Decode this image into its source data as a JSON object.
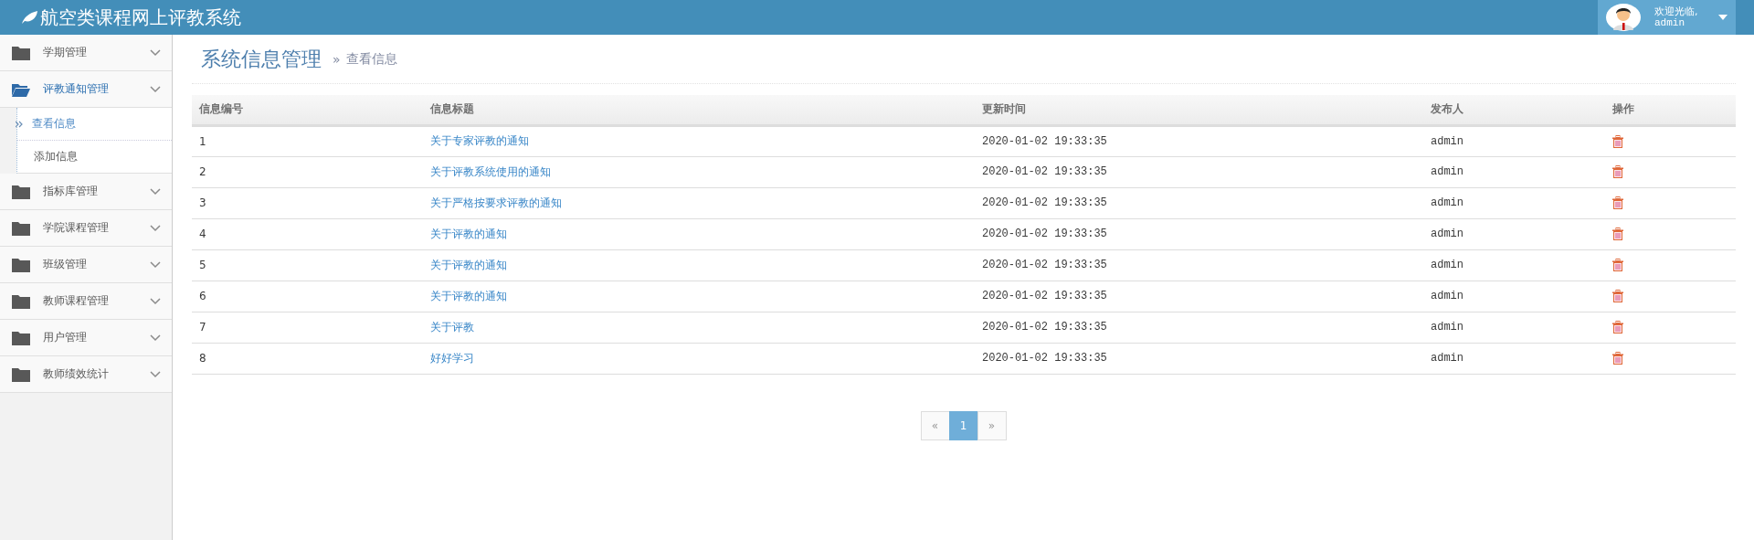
{
  "header": {
    "title": "航空类课程网上评教系统",
    "user": {
      "greeting": "欢迎光临,",
      "name": "admin"
    }
  },
  "sidebar": {
    "items": [
      {
        "label": "学期管理",
        "expanded": false
      },
      {
        "label": "评教通知管理",
        "expanded": true,
        "children": [
          {
            "label": "查看信息",
            "selected": true
          },
          {
            "label": "添加信息",
            "selected": false
          }
        ]
      },
      {
        "label": "指标库管理",
        "expanded": false
      },
      {
        "label": "学院课程管理",
        "expanded": false
      },
      {
        "label": "班级管理",
        "expanded": false
      },
      {
        "label": "教师课程管理",
        "expanded": false
      },
      {
        "label": "用户管理",
        "expanded": false
      },
      {
        "label": "教师绩效统计",
        "expanded": false
      }
    ]
  },
  "page": {
    "title": "系统信息管理",
    "breadcrumb_mark": "»",
    "subtitle": "查看信息"
  },
  "table": {
    "columns": [
      "信息编号",
      "信息标题",
      "更新时间",
      "发布人",
      "操作"
    ],
    "rows": [
      {
        "id": "1",
        "title": "关于专家评教的通知",
        "time": "2020-01-02 19:33:35",
        "author": "admin"
      },
      {
        "id": "2",
        "title": "关于评教系统使用的通知",
        "time": "2020-01-02 19:33:35",
        "author": "admin"
      },
      {
        "id": "3",
        "title": "关于严格按要求评教的通知",
        "time": "2020-01-02 19:33:35",
        "author": "admin"
      },
      {
        "id": "4",
        "title": "关于评教的通知",
        "time": "2020-01-02 19:33:35",
        "author": "admin"
      },
      {
        "id": "5",
        "title": "关于评教的通知",
        "time": "2020-01-02 19:33:35",
        "author": "admin"
      },
      {
        "id": "6",
        "title": "关于评教的通知",
        "time": "2020-01-02 19:33:35",
        "author": "admin"
      },
      {
        "id": "7",
        "title": "关于评教",
        "time": "2020-01-02 19:33:35",
        "author": "admin"
      },
      {
        "id": "8",
        "title": "好好学习",
        "time": "2020-01-02 19:33:35",
        "author": "admin"
      }
    ]
  },
  "pagination": {
    "prev": "«",
    "pages": [
      {
        "label": "1",
        "selected": true
      }
    ],
    "next": "»"
  }
}
